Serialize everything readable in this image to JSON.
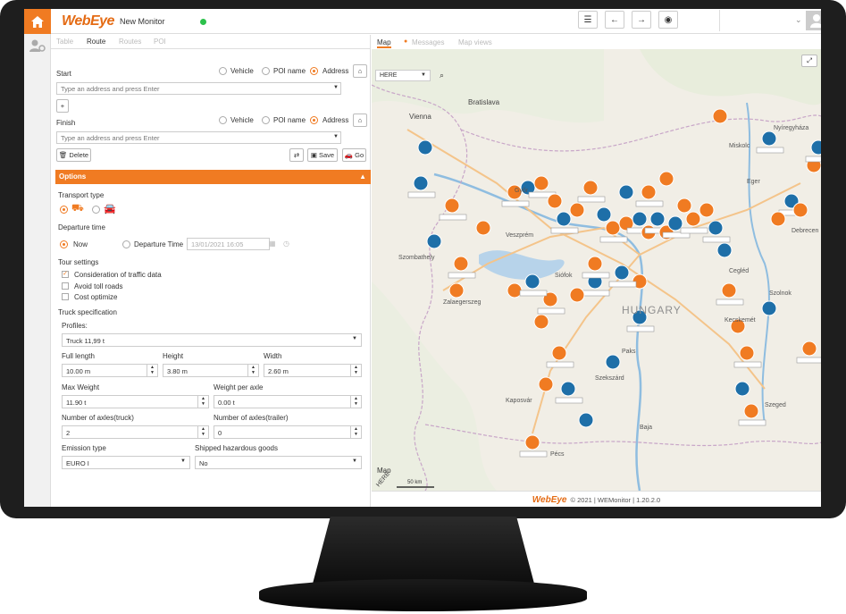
{
  "app": {
    "logo_text": "WebEye",
    "window_title": "New Monitor"
  },
  "toolbar": {
    "list_icon": "list-icon",
    "back_icon": "arrow-left-icon",
    "forward_icon": "arrow-right-icon",
    "globe_icon": "globe-icon"
  },
  "left_tabs": [
    "Table",
    "Route",
    "Routes",
    "POI"
  ],
  "start": {
    "label": "Start",
    "options": [
      "Vehicle",
      "POI name",
      "Address"
    ],
    "selected": "Address",
    "placeholder": "Type an address and press Enter"
  },
  "finish": {
    "label": "Finish",
    "options": [
      "Vehicle",
      "POI name",
      "Address"
    ],
    "selected": "Address",
    "placeholder": "Type an address and press Enter"
  },
  "buttons": {
    "add": "+",
    "delete": "Delete",
    "save": "Save",
    "go": "Go"
  },
  "options": {
    "header": "Options",
    "transport_type": "Transport type",
    "departure_time": "Departure time",
    "now": "Now",
    "departure_time_opt": "Departure Time",
    "departure_value": "13/01/2021 16:05",
    "tour_settings": "Tour settings",
    "traffic": "Consideration of traffic data",
    "toll": "Avoid toll roads",
    "cost": "Cost optimize",
    "truck_spec": "Truck specification",
    "profiles_label": "Profiles:",
    "profile_value": "Truck 11,99 t",
    "full_length_label": "Full length",
    "full_length": "10.00 m",
    "height_label": "Height",
    "height": "3.80 m",
    "width_label": "Width",
    "width": "2.60 m",
    "max_weight_label": "Max Weight",
    "max_weight": "11.90 t",
    "weight_axle_label": "Weight per axle",
    "weight_axle": "0.00 t",
    "axles_truck_label": "Number of axles(truck)",
    "axles_truck": "2",
    "axles_trailer_label": "Number of axles(trailer)",
    "axles_trailer": "0",
    "emission_label": "Emission type",
    "emission": "EURO I",
    "hazard_label": "Shipped hazardous goods",
    "hazard": "No"
  },
  "map": {
    "tabs": [
      "Map",
      "Messages",
      "Map views"
    ],
    "provider": "HERE",
    "cities": [
      "Vienna",
      "Bratislava",
      "HUNGARY",
      "Miskolc",
      "Győr",
      "Szombathely",
      "Zalaegerszeg",
      "Kaposvár",
      "Pécs",
      "Szeged",
      "Debrecen",
      "Nyíregyháza",
      "Kecskemét",
      "Szolnok",
      "Eger",
      "Cegléd",
      "Baja",
      "Szekszárd",
      "Paks",
      "Siófok",
      "Veszprém",
      "Kecskeméti"
    ],
    "scale": "50 km",
    "attribution": "HERE",
    "map_label": "Map"
  },
  "footer": {
    "brand": "WebEye",
    "text": "© 2021 | WEMonitor | 1.20.2.0"
  },
  "colors": {
    "accent": "#f07b22",
    "marker_blue": "#1e6fa8",
    "marker_orange": "#f07b22"
  }
}
